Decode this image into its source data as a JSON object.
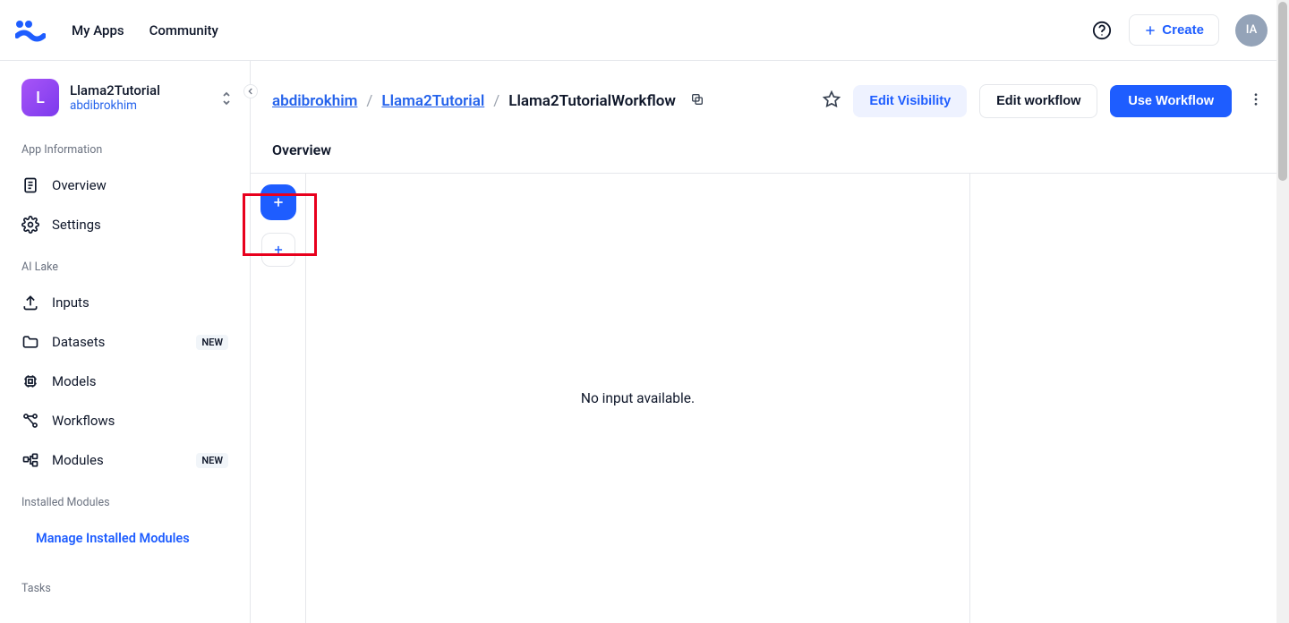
{
  "header": {
    "nav": [
      "My Apps",
      "Community"
    ],
    "create_label": "Create",
    "avatar_initials": "IA"
  },
  "sidebar": {
    "app_initial": "L",
    "app_title": "Llama2Tutorial",
    "app_user": "abdibrokhim",
    "section_app_info": "App Information",
    "item_overview": "Overview",
    "item_settings": "Settings",
    "section_ai_lake": "AI Lake",
    "item_inputs": "Inputs",
    "item_datasets": "Datasets",
    "item_models": "Models",
    "item_workflows": "Workflows",
    "item_modules": "Modules",
    "badge_new": "NEW",
    "section_installed": "Installed Modules",
    "manage_link": "Manage Installed Modules",
    "section_tasks": "Tasks"
  },
  "content": {
    "breadcrumb": {
      "user": "abdibrokhim",
      "project": "Llama2Tutorial",
      "current": "Llama2TutorialWorkflow"
    },
    "actions": {
      "edit_visibility": "Edit Visibility",
      "edit_workflow": "Edit workflow",
      "use_workflow": "Use Workflow"
    },
    "section_title": "Overview",
    "empty_message": "No input available."
  },
  "colors": {
    "primary": "#1e5dff",
    "highlight": "#e8001d"
  }
}
